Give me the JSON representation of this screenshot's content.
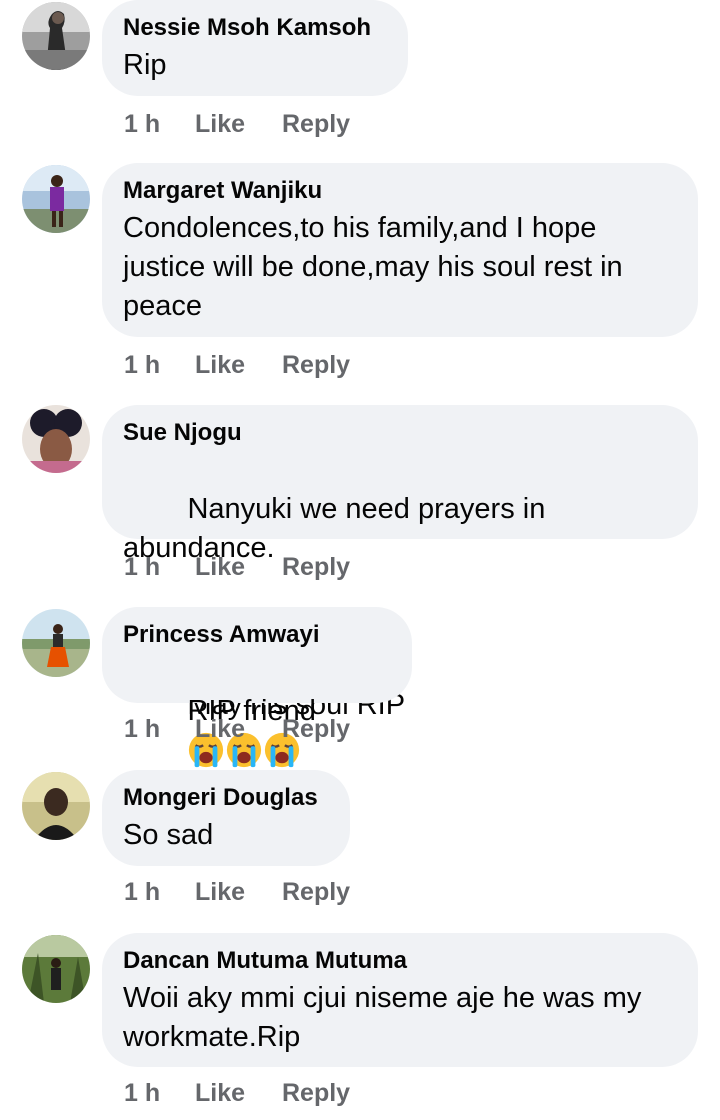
{
  "colors": {
    "bubble": "#f0f2f5",
    "meta_text": "#65676b",
    "body_text": "#050505"
  },
  "comments": [
    {
      "author": "Nessie Msoh Kamsoh",
      "text": "Rip",
      "time": "1 h",
      "like": "Like",
      "reply": "Reply",
      "avatar_icon": "profile-photo"
    },
    {
      "author": "Margaret Wanjiku",
      "text": "Condolences,to his family,and I hope justice will be done,may his soul rest in peace",
      "time": "1 h",
      "like": "Like",
      "reply": "Reply",
      "avatar_icon": "profile-photo"
    },
    {
      "author": "Sue Njogu",
      "text": "Nanyuki we need prayers in abundance.",
      "text_after_emoji": "May his soul RIP",
      "emojis": [
        "sad-tear-emoji",
        "sad-tear-emoji",
        "sad-tear-emoji",
        "sad-tear-emoji"
      ],
      "time": "1 h",
      "like": "Like",
      "reply": "Reply",
      "avatar_icon": "profile-photo"
    },
    {
      "author": "Princess Amwayi",
      "text": "RIP friend",
      "emojis": [
        "loudly-crying-emoji",
        "loudly-crying-emoji",
        "loudly-crying-emoji"
      ],
      "time": "1 h",
      "like": "Like",
      "reply": "Reply",
      "avatar_icon": "profile-photo"
    },
    {
      "author": "Mongeri Douglas",
      "text": "So sad",
      "time": "1 h",
      "like": "Like",
      "reply": "Reply",
      "avatar_icon": "profile-photo"
    },
    {
      "author": "Dancan Mutuma Mutuma",
      "text": "Woii aky mmi cjui niseme aje he was my workmate.Rip",
      "time": "1 h",
      "like": "Like",
      "reply": "Reply",
      "avatar_icon": "profile-photo"
    }
  ]
}
